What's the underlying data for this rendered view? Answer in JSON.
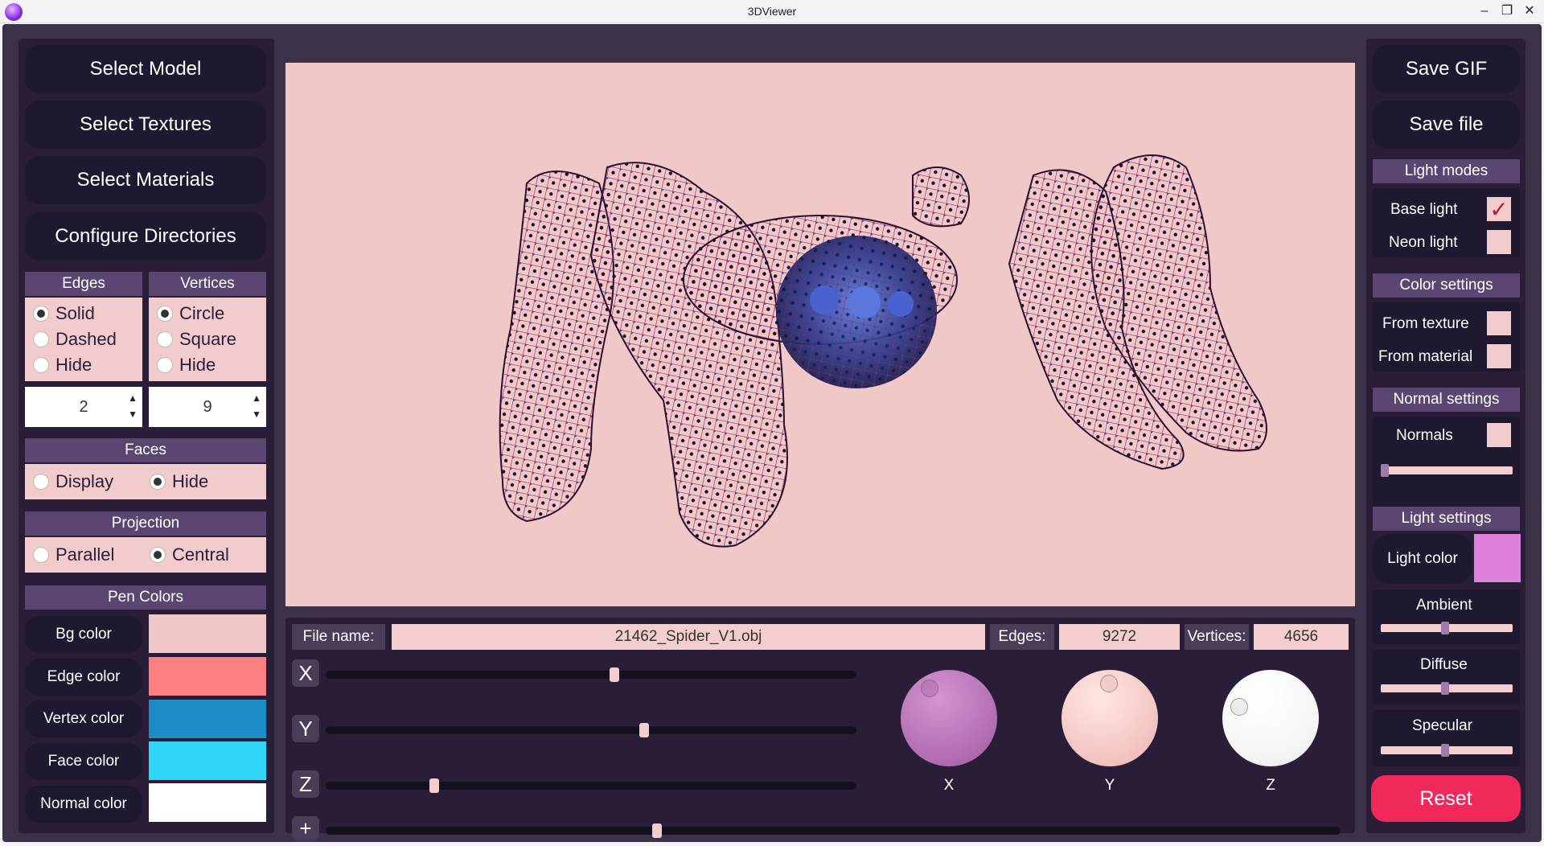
{
  "window": {
    "title": "3DViewer",
    "minimize": "–",
    "restore": "❐",
    "close": "✕"
  },
  "left": {
    "select_model": "Select Model",
    "select_textures": "Select Textures",
    "select_materials": "Select Materials",
    "configure_dirs": "Configure Directories",
    "edges": {
      "header": "Edges",
      "options": [
        "Solid",
        "Dashed",
        "Hide"
      ],
      "selected": "Solid",
      "value": "2"
    },
    "vertices": {
      "header": "Vertices",
      "options": [
        "Circle",
        "Square",
        "Hide"
      ],
      "selected": "Circle",
      "value": "9"
    },
    "faces": {
      "header": "Faces",
      "options": [
        "Display",
        "Hide"
      ],
      "selected": "Hide"
    },
    "projection": {
      "header": "Projection",
      "options": [
        "Parallel",
        "Central"
      ],
      "selected": "Central"
    },
    "pen_colors": {
      "header": "Pen Colors",
      "items": [
        {
          "label": "Bg color",
          "color": "#f0c8c8"
        },
        {
          "label": "Edge color",
          "color": "#fd7f7f"
        },
        {
          "label": "Vertex color",
          "color": "#1b8dc4"
        },
        {
          "label": "Face color",
          "color": "#30d6f6"
        },
        {
          "label": "Normal color",
          "color": "#ffffff"
        }
      ]
    }
  },
  "bottom": {
    "file_name_label": "File name:",
    "file_name": "21462_Spider_V1.obj",
    "edges_label": "Edges:",
    "edges": "9272",
    "vertices_label": "Vertices:",
    "vertices": "4656",
    "sliders": [
      {
        "label": "X",
        "value": 0.54
      },
      {
        "label": "Y",
        "value": 0.6
      },
      {
        "label": "Z",
        "value": 0.2
      },
      {
        "label": "+",
        "value": 0.33
      }
    ],
    "knobs": [
      {
        "label": "X",
        "color": "#b870b8"
      },
      {
        "label": "Y",
        "color": "#f4c8c4"
      },
      {
        "label": "Z",
        "color": "#ffffff"
      }
    ]
  },
  "right": {
    "save_gif": "Save GIF",
    "save_file": "Save file",
    "light_modes": {
      "header": "Light modes",
      "base_light": "Base light",
      "base_checked": "✓",
      "neon_light": "Neon light"
    },
    "color_settings": {
      "header": "Color settings",
      "from_texture": "From texture",
      "from_material": "From material"
    },
    "normal_settings": {
      "header": "Normal settings",
      "normals": "Normals",
      "slider": 0.03
    },
    "light_settings": {
      "header": "Light settings",
      "light_color_label": "Light color",
      "light_color": "#dc82dc",
      "ambient": "Ambient",
      "ambient_value": 0.47,
      "diffuse": "Diffuse",
      "diffuse_value": 0.47,
      "specular": "Specular",
      "specular_value": 0.47
    },
    "reset": "Reset"
  },
  "colors": {
    "accent": "#f0295a",
    "panel": "#2a1d38",
    "frame": "#3b3148"
  }
}
